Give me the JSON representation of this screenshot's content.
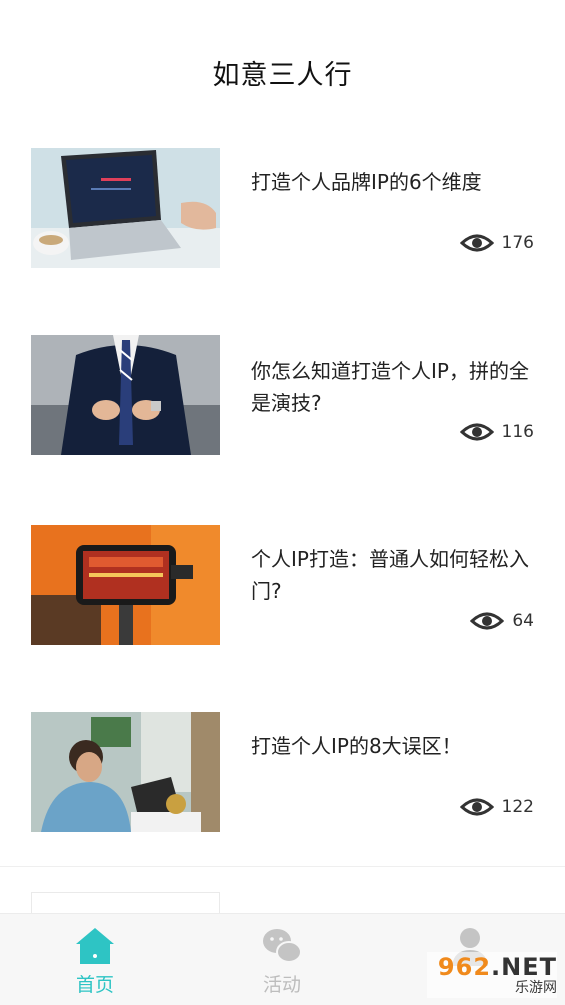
{
  "header": {
    "title": "如意三人行"
  },
  "articles": [
    {
      "title": "打造个人品牌IP的6个维度",
      "views": "176",
      "image": "laptop-on-table"
    },
    {
      "title": "你怎么知道打造个人IP，拼的全是演技?",
      "views": "116",
      "image": "man-in-suit"
    },
    {
      "title": "个人IP打造：普通人如何轻松入门?",
      "views": "64",
      "image": "phone-on-gimbal"
    },
    {
      "title": "打造个人IP的8大误区！",
      "views": "122",
      "image": "man-at-desk"
    }
  ],
  "tabbar": {
    "tabs": [
      {
        "label": "首页",
        "icon": "home-icon",
        "active": true
      },
      {
        "label": "活动",
        "icon": "chat-icon",
        "active": false
      },
      {
        "label": "",
        "icon": "person-icon",
        "active": false
      }
    ]
  },
  "watermark": {
    "main_prefix": "962",
    "main_suffix": ".NET",
    "sub": "乐游网"
  },
  "colors": {
    "accent": "#2ec4c4",
    "inactive": "#bdbdbd",
    "text": "#222222"
  }
}
